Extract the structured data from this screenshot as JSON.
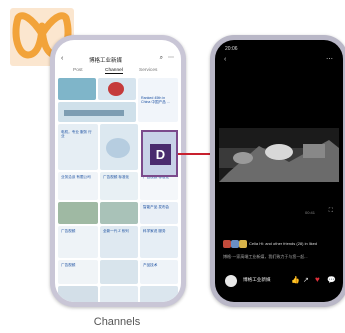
{
  "logo": {
    "icon": "orange-loop-logo-icon",
    "color": "#f2a33a"
  },
  "badge": {
    "label": "D"
  },
  "connector_color": "#c8202e",
  "left_phone": {
    "time": "",
    "title": "博格工业新媒",
    "tabs": [
      "Post",
      "Channel",
      "Services"
    ],
    "cells": [
      {
        "caption": "Ranked 45th in China 中国产品 …"
      },
      {
        "caption": "Ranked 45th in China"
      },
      {
        "caption": "电机，专业 服务 行业"
      },
      {
        "caption": "业务洽谈 有限公司"
      },
      {
        "caption": "广告视频 标准化"
      },
      {
        "caption": "广告视频 标准化"
      },
      {
        "caption": "智能产品 发布会"
      },
      {
        "caption": "广告视频"
      },
      {
        "caption": "全新一代 Z 系列"
      },
      {
        "caption": "科学家说 服务"
      },
      {
        "caption": "广告视频"
      },
      {
        "caption": "产品技术"
      }
    ]
  },
  "right_phone": {
    "time": "20:06",
    "back": "‹",
    "overlay_text": "Celia Hi: and other friends (28) in liked",
    "description": "博格·一家高端工业新媒，我们致力于与您一起...",
    "account": "博格工业新媒",
    "timestamp": "00:41"
  },
  "caption": "Channels"
}
